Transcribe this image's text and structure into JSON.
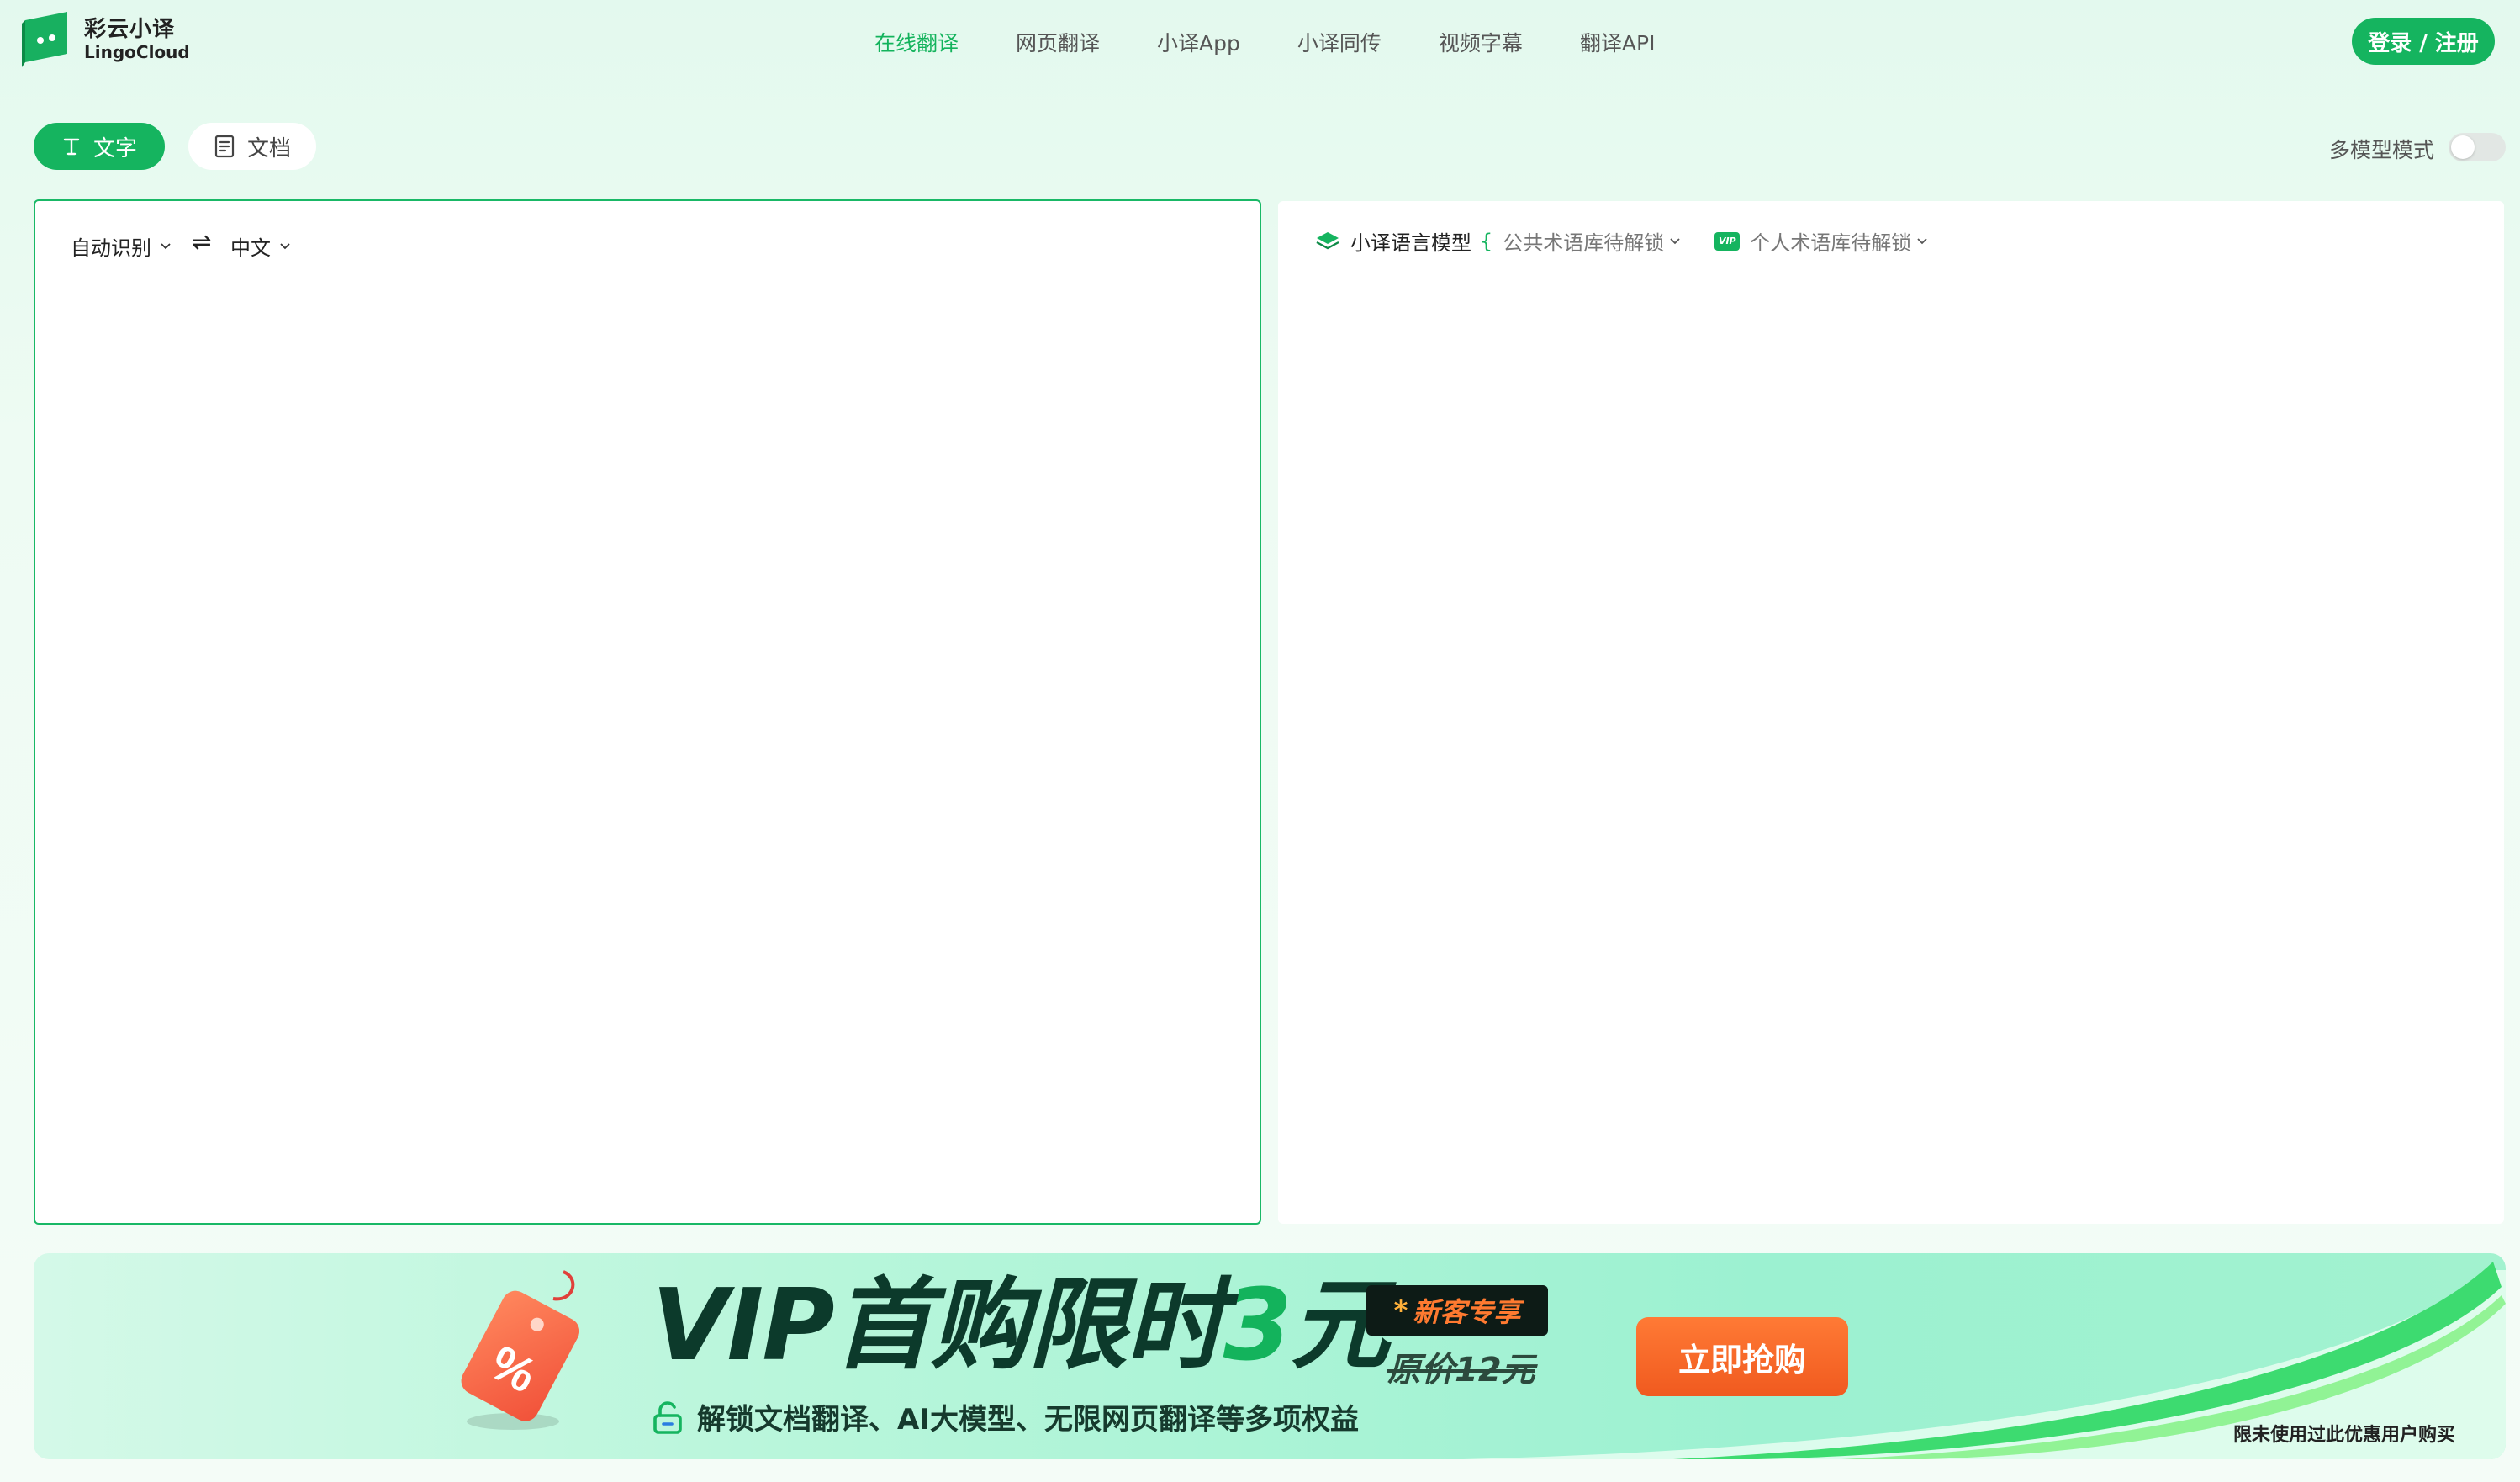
{
  "header": {
    "brand_cn": "彩云小译",
    "brand_en": "LingoCloud",
    "nav": [
      {
        "label": "在线翻译",
        "active": true
      },
      {
        "label": "网页翻译",
        "active": false
      },
      {
        "label": "小译App",
        "active": false
      },
      {
        "label": "小译同传",
        "active": false
      },
      {
        "label": "视频字幕",
        "active": false
      },
      {
        "label": "翻译API",
        "active": false
      }
    ],
    "login_label": "登录 / 注册",
    "icon": "logo-icon"
  },
  "modes": {
    "text_label": "文字",
    "doc_label": "文档",
    "multi_model_label": "多模型模式",
    "multi_model_on": false
  },
  "source": {
    "from_lang": "自动识别",
    "swap_icon": "⇌",
    "to_lang": "中文"
  },
  "target": {
    "model_label": "小译语言模型",
    "public_terms": "公共术语库待解锁",
    "vip_badge": "VIP",
    "personal_terms": "个人术语库待解锁"
  },
  "banner": {
    "title_prefix": "VIP首购限时",
    "title_number": "3",
    "title_suffix": "元",
    "badge_star": "*",
    "badge_text": "新客专享",
    "original_price": "原价12元",
    "subtitle": "解锁文档翻译、AI大模型、无限网页翻译等多项权益",
    "buy_label": "立即抢购",
    "limit_note": "限未使用过此优惠用户购买"
  },
  "colors": {
    "accent": "#15b45f",
    "orange": "#f05a1f",
    "dark_green": "#0c3a2b"
  }
}
